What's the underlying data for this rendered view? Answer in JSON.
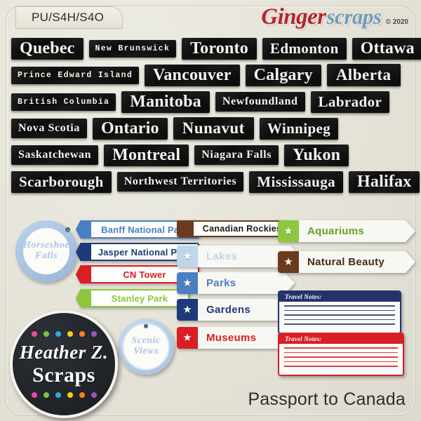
{
  "header": {
    "tab_text": "PU/S4H/S4O",
    "brand_part1": "Ginger",
    "brand_part2": "scraps",
    "copyright": "© 2020"
  },
  "footer": {
    "title": "Passport to Canada"
  },
  "colors": {
    "background": "#e9e7dc",
    "label_black": "#121212",
    "brand_red": "#b4242c",
    "brand_blue": "#6f9cb6",
    "tag_blue": "#a9c6e4",
    "banff_blue": "#4a7fc1",
    "jasper_navy": "#1f3a7a",
    "cn_red": "#d91e24",
    "stanley_green": "#8dc63f",
    "rockies_brown": "#6b3b1e",
    "lakes_lightblue": "#bfd6ea",
    "parks_blue": "#4a7fc1",
    "gardens_navy": "#1f3a7a",
    "museums_red": "#d91e24",
    "aquariums_green": "#8dc63f",
    "natural_brown": "#6b3b1e"
  },
  "word_labels": {
    "rows": [
      [
        {
          "text": "Quebec",
          "size": "xl"
        },
        {
          "text": "New Brunswick",
          "size": "s"
        },
        {
          "text": "Toronto",
          "size": "xl"
        },
        {
          "text": "Edmonton",
          "size": "l"
        },
        {
          "text": "Ottawa",
          "size": "xl"
        }
      ],
      [
        {
          "text": "Prince Edward Island",
          "size": "s"
        },
        {
          "text": "Vancouver",
          "size": "xl"
        },
        {
          "text": "Calgary",
          "size": "xl"
        },
        {
          "text": "Alberta",
          "size": "bold-blk"
        }
      ],
      [
        {
          "text": "British Columbia",
          "size": "s"
        },
        {
          "text": "Manitoba",
          "size": "xl"
        },
        {
          "text": "Newfoundland",
          "size": "m"
        },
        {
          "text": "Labrador",
          "size": "l"
        }
      ],
      [
        {
          "text": "Nova Scotia",
          "size": "m"
        },
        {
          "text": "Ontario",
          "size": "xl"
        },
        {
          "text": "Nunavut",
          "size": "bold-blk"
        },
        {
          "text": "Winnipeg",
          "size": "l"
        }
      ],
      [
        {
          "text": "Saskatchewan",
          "size": "m"
        },
        {
          "text": "Montreal",
          "size": "xl"
        },
        {
          "text": "Niagara Falls",
          "size": "m"
        },
        {
          "text": "Yukon",
          "size": "xl"
        }
      ],
      [
        {
          "text": "Scarborough",
          "size": "l"
        },
        {
          "text": "Northwest Territories",
          "size": "m"
        },
        {
          "text": "Mississauga",
          "size": "l"
        },
        {
          "text": "Halifax",
          "size": "xl"
        }
      ]
    ]
  },
  "circle_tags": [
    {
      "line1": "Horseshoe",
      "line2": "Falls"
    },
    {
      "line1": "Scenic",
      "line2": "Views"
    }
  ],
  "name_plates": [
    {
      "label": "Banff National Park",
      "color": "#4a7fc1"
    },
    {
      "label": "Jasper National Park",
      "color": "#1f3a7a"
    },
    {
      "label": "CN Tower",
      "color": "#d91e24"
    },
    {
      "label": "Stanley Park",
      "color": "#8dc63f"
    }
  ],
  "arrow_signs": [
    {
      "label": "Canadian Rockies",
      "color": "#6b3b1e",
      "shape": "rect"
    },
    {
      "label": "Lakes",
      "color": "#bfd6ea",
      "text_color": "#bfd6ea",
      "shape": "arrow"
    },
    {
      "label": "Parks",
      "color": "#4a7fc1",
      "text_color": "#4a7fc1",
      "shape": "arrow"
    },
    {
      "label": "Gardens",
      "color": "#1f3a7a",
      "text_color": "#1f3a7a",
      "shape": "arrow"
    },
    {
      "label": "Museums",
      "color": "#d91e24",
      "text_color": "#d91e24",
      "shape": "arrow"
    },
    {
      "label": "Aquariums",
      "color": "#8dc63f",
      "text_color": "#6f9e22",
      "shape": "arrow"
    },
    {
      "label": "Natural Beauty",
      "color": "#6b3b1e",
      "text_color": "#4a2a14",
      "shape": "arrow"
    }
  ],
  "travel_notes": [
    {
      "heading": "Travel Notes:",
      "color": "#24346b",
      "lines": 5
    },
    {
      "heading": "Travel Notes:",
      "color": "#d91e24",
      "lines": 5
    }
  ],
  "brand_logo": {
    "name": "Heather Z.",
    "sub": "Scraps",
    "dot_colors": [
      "#ef4a9b",
      "#7dc242",
      "#29a8df",
      "#f5d014",
      "#f58220",
      "#9a58b5"
    ]
  },
  "star_glyph": "★"
}
